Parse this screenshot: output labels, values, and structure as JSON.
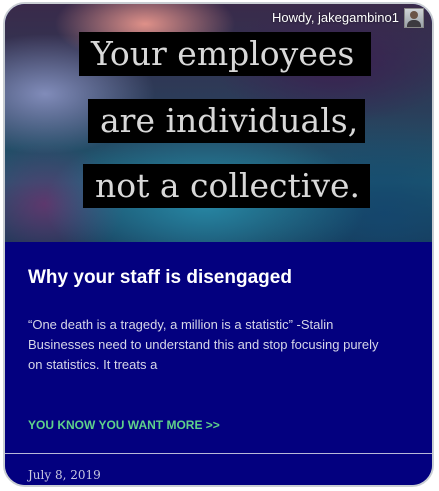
{
  "hero": {
    "quote_lines": [
      "Your employees",
      "are individuals,",
      "not a collective."
    ]
  },
  "user": {
    "greeting": "Howdy, jakegambino1",
    "avatar_icon": "user-avatar"
  },
  "post": {
    "title": "Why your staff is disengaged",
    "excerpt_lines": [
      "“One death is a tragedy, a million is a statistic” -Stalin",
      "Businesses need to understand this and stop focusing purely",
      "on statistics. It treats a"
    ],
    "read_more_label": "YOU KNOW YOU WANT MORE >>",
    "date": "July 8, 2019"
  },
  "colors": {
    "content_bg": "#03007f",
    "link": "#5fd28a",
    "quote_box": "#000000"
  }
}
